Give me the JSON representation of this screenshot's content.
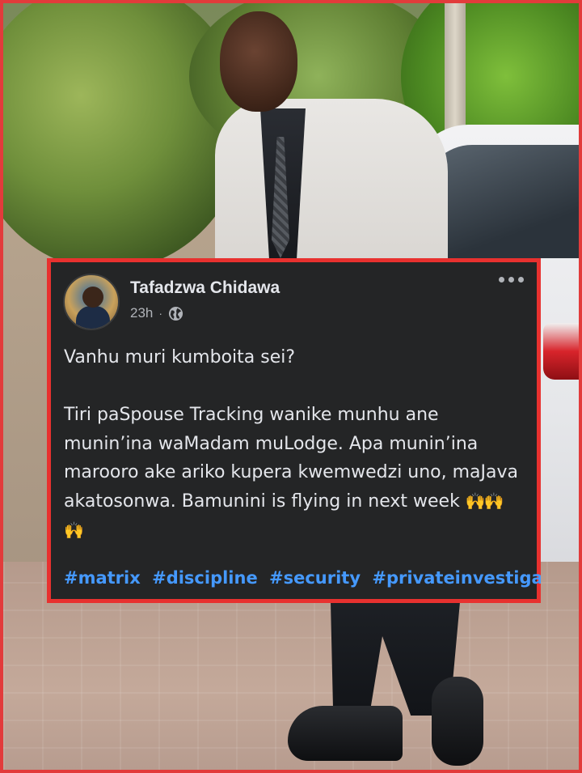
{
  "post": {
    "author": "Tafadzwa Chidawa",
    "time": "23h",
    "separator": "·",
    "privacy_icon": "globe-icon",
    "menu_icon": "more-horizontal-icon",
    "lines": [
      "Vanhu muri kumboita sei?",
      "",
      "Tiri paSpouse Tracking wanike munhu ane",
      "munin’ina waMadam muLodge. Apa munin’ina",
      "marooro ake ariko kupera kwemwedzi uno, maJava",
      "akatosonwa. Bamunini is flying in next week"
    ],
    "emoji_line_end": "🙌🙌",
    "emoji_line_last": "🙌",
    "hashtags": [
      "#matrix",
      "#discipline",
      "#security",
      "#privateinvestigatio"
    ]
  },
  "colors": {
    "card_bg": "#242526",
    "card_border": "#e8312f",
    "text_primary": "#e4e6eb",
    "text_secondary": "#b0b3b8",
    "hashtag": "#4599ff",
    "image_frame": "#e23b3b"
  }
}
